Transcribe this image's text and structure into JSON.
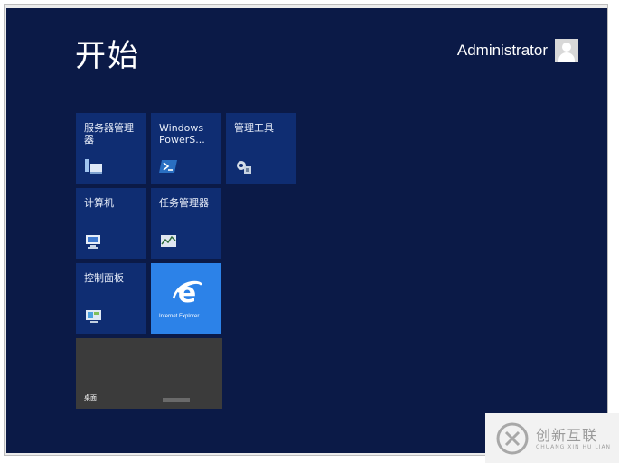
{
  "start": {
    "title": "开始"
  },
  "user": {
    "name": "Administrator"
  },
  "tiles": [
    {
      "label": "服务器管理器",
      "icon": "server-manager-icon"
    },
    {
      "label": "Windows PowerS...",
      "icon": "powershell-icon"
    },
    {
      "label": "管理工具",
      "icon": "admin-tools-icon"
    },
    {
      "label": "计算机",
      "icon": "computer-icon"
    },
    {
      "label": "任务管理器",
      "icon": "task-manager-icon"
    },
    {
      "label": "控制面板",
      "icon": "control-panel-icon"
    },
    {
      "label": "Internet Explorer",
      "icon": "internet-explorer-icon"
    },
    {
      "label": "桌面",
      "icon": "desktop-icon"
    }
  ],
  "colors": {
    "background": "#0b1a47",
    "tile": "#0f2d72",
    "ie_tile": "#2c82e8",
    "desktop_tile": "#3b3b3b"
  },
  "watermark": {
    "brand": "创新互联",
    "sub": "CHUANG XIN HU LIAN"
  }
}
